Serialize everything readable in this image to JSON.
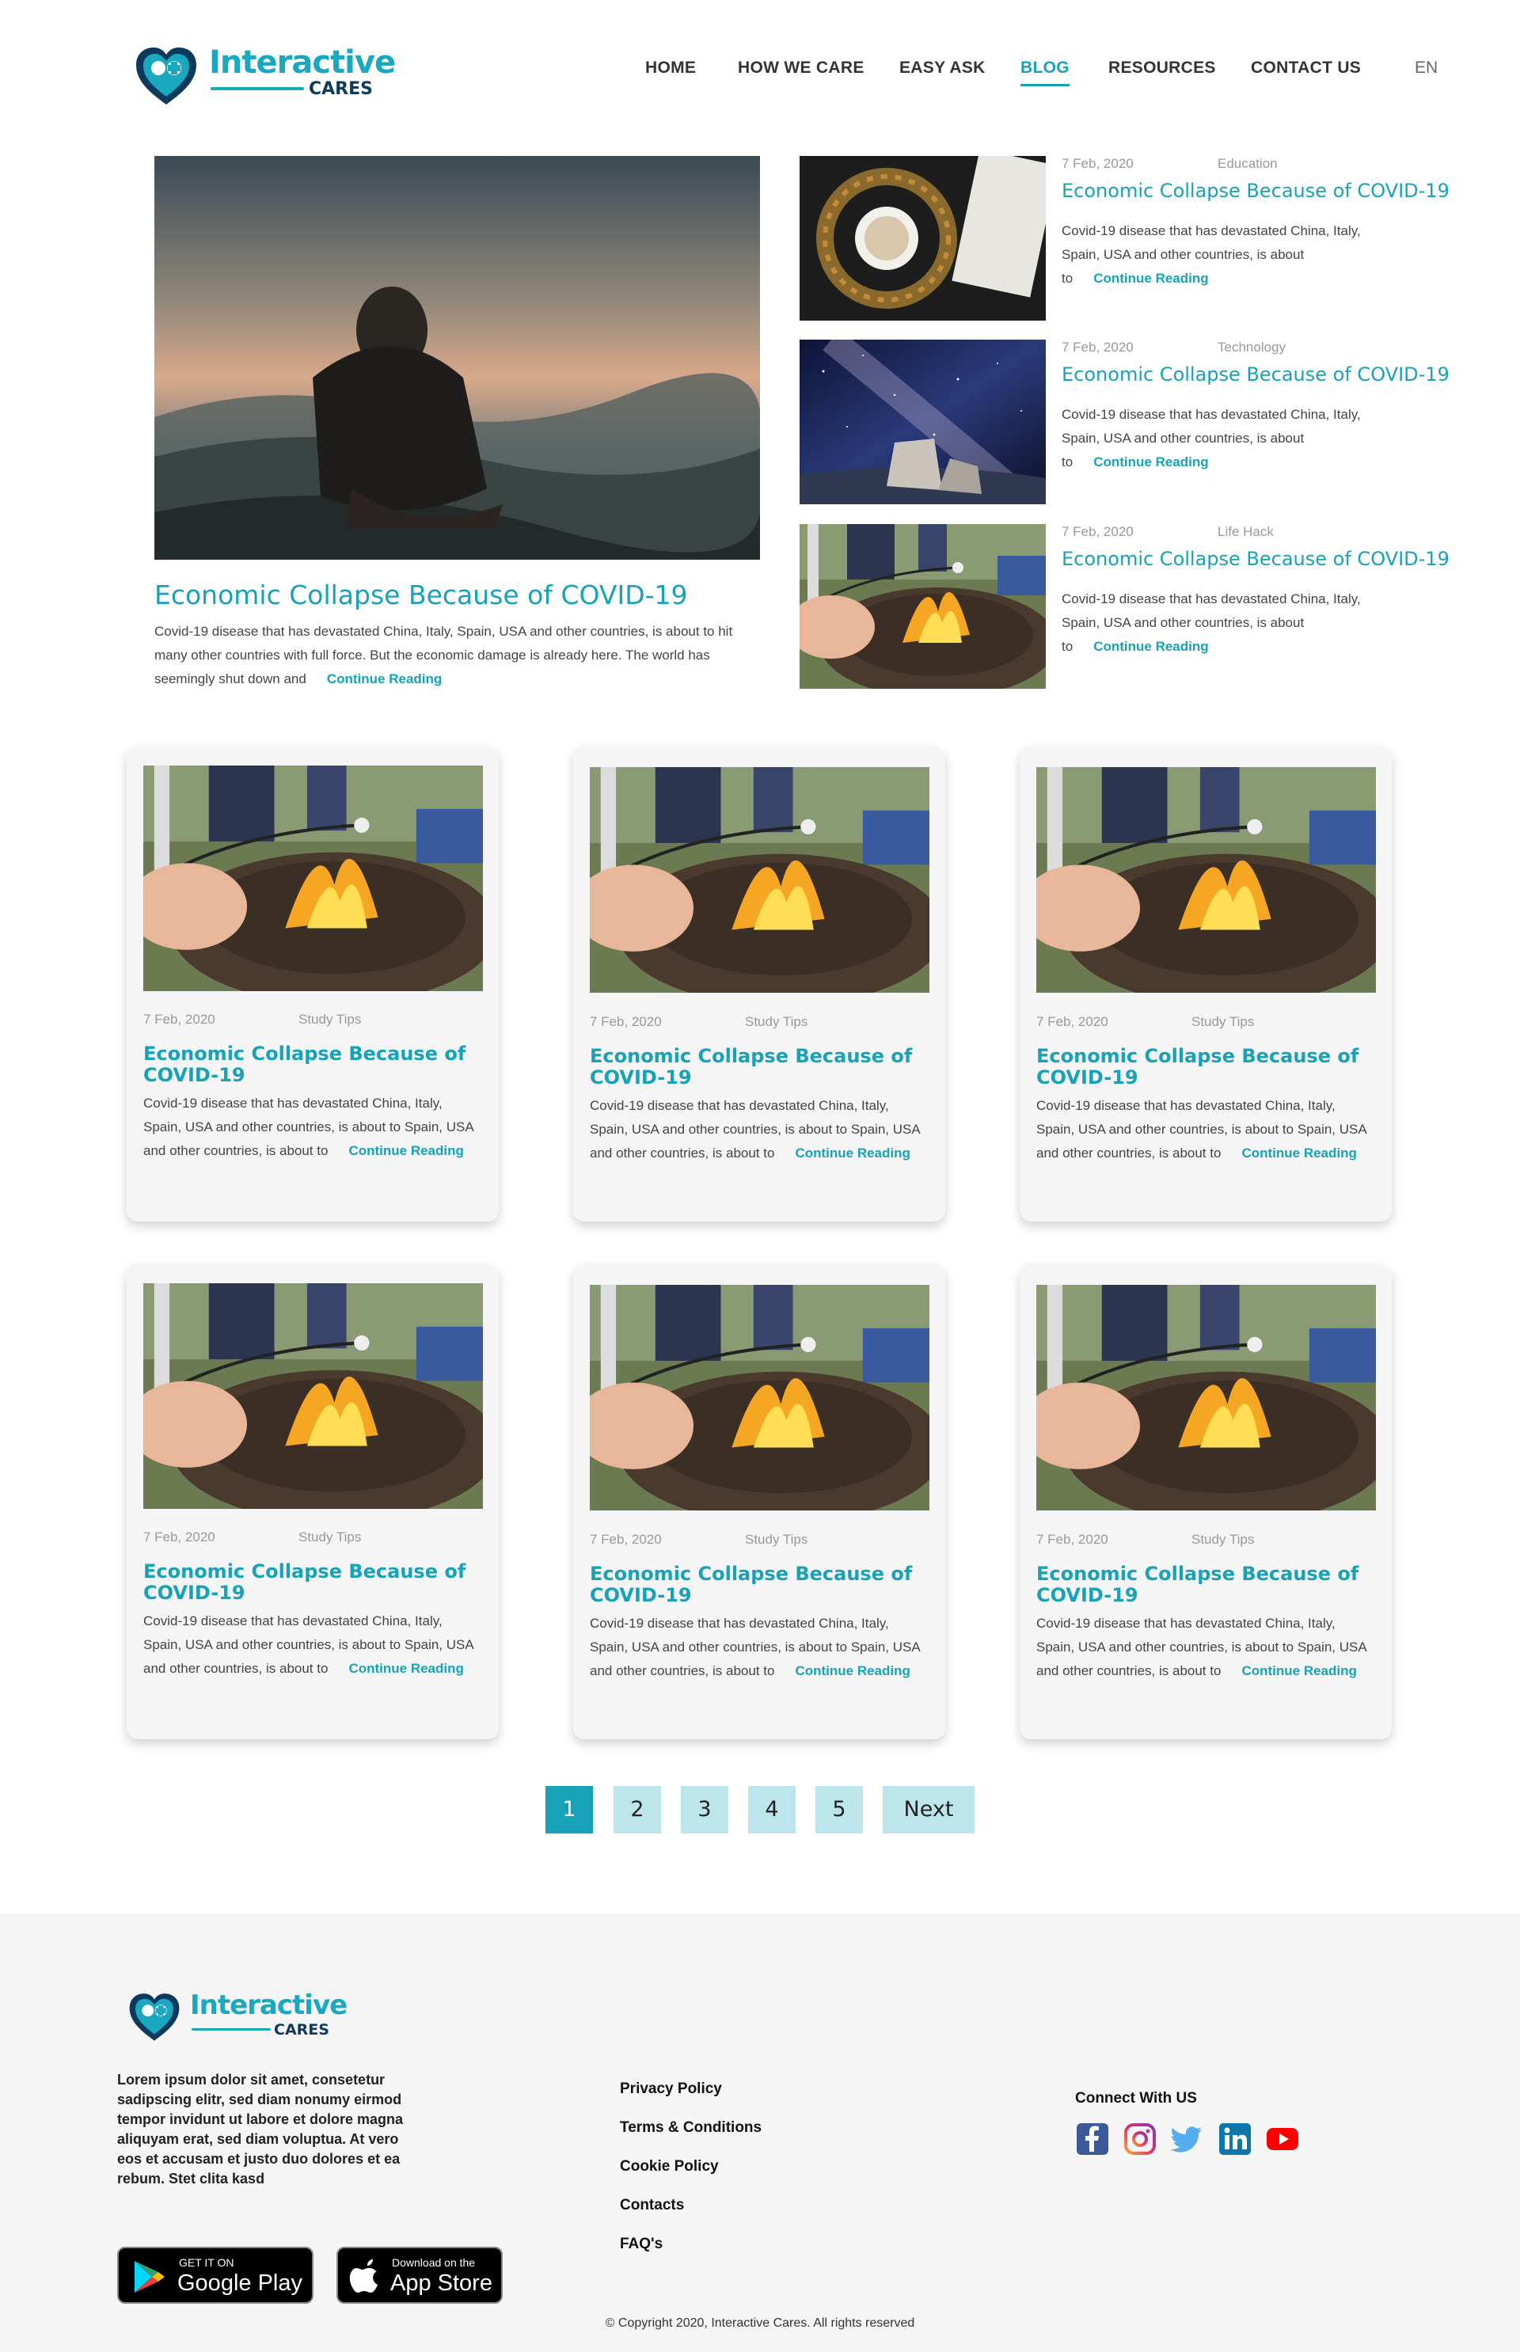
{
  "brand": {
    "name": "Interactive",
    "sub": "CARES",
    "accent": "#17a2b8",
    "dark": "#0d3a5c"
  },
  "nav": {
    "items": [
      {
        "label": "HOME",
        "active": false
      },
      {
        "label": "HOW WE CARE",
        "active": false
      },
      {
        "label": "EASY ASK",
        "active": false
      },
      {
        "label": "BLOG",
        "active": true
      },
      {
        "label": "RESOURCES",
        "active": false
      },
      {
        "label": "CONTACT US",
        "active": false
      }
    ],
    "lang": "EN"
  },
  "featured": {
    "title": "Economic Collapse Because of COVID-19",
    "text": "Covid-19 disease that has devastated China, Italy, Spain, USA and other countries, is about to hit many other countries with full force. But the economic damage is already here. The world has seemingly shut down and",
    "link": "Continue Reading"
  },
  "side": [
    {
      "date": "7 Feb, 2020",
      "category": "Education",
      "title": "Economic Collapse Because of COVID-19",
      "text": "Covid-19 disease that has devastated China, Italy, Spain, USA and other countries, is about to",
      "link": "Continue Reading"
    },
    {
      "date": "7 Feb, 2020",
      "category": "Technology",
      "title": "Economic Collapse Because of COVID-19",
      "text": "Covid-19 disease that has devastated China, Italy, Spain, USA and other countries, is about to",
      "link": "Continue Reading"
    },
    {
      "date": "7 Feb, 2020",
      "category": "Life Hack",
      "title": "Economic Collapse Because of COVID-19",
      "text": "Covid-19 disease that has devastated China, Italy, Spain, USA and other countries, is about to",
      "link": "Continue Reading"
    }
  ],
  "cards": [
    {
      "date": "7 Feb, 2020",
      "category": "Study Tips",
      "title": "Economic Collapse Because of COVID-19",
      "text": "Covid-19 disease that has devastated China, Italy, Spain, USA and other countries, is about to Spain, USA and other countries, is about to",
      "link": "Continue Reading"
    },
    {
      "date": "7 Feb, 2020",
      "category": "Study Tips",
      "title": "Economic Collapse Because of COVID-19",
      "text": "Covid-19 disease that has devastated China, Italy, Spain, USA and other countries, is about to Spain, USA and other countries, is about to",
      "link": "Continue Reading"
    },
    {
      "date": "7 Feb, 2020",
      "category": "Study Tips",
      "title": "Economic Collapse Because of COVID-19",
      "text": "Covid-19 disease that has devastated China, Italy, Spain, USA and other countries, is about to Spain, USA and other countries, is about to",
      "link": "Continue Reading"
    },
    {
      "date": "7 Feb, 2020",
      "category": "Study Tips",
      "title": "Economic Collapse Because of COVID-19",
      "text": "Covid-19 disease that has devastated China, Italy, Spain, USA and other countries, is about to Spain, USA and other countries, is about to",
      "link": "Continue Reading"
    },
    {
      "date": "7 Feb, 2020",
      "category": "Study Tips",
      "title": "Economic Collapse Because of COVID-19",
      "text": "Covid-19 disease that has devastated China, Italy, Spain, USA and other countries, is about to Spain, USA and other countries, is about to",
      "link": "Continue Reading"
    },
    {
      "date": "7 Feb, 2020",
      "category": "Study Tips",
      "title": "Economic Collapse Because of COVID-19",
      "text": "Covid-19 disease that has devastated China, Italy, Spain, USA and other countries, is about to Spain, USA and other countries, is about to",
      "link": "Continue Reading"
    }
  ],
  "pagination": {
    "pages": [
      "1",
      "2",
      "3",
      "4",
      "5"
    ],
    "current": "1",
    "next": "Next"
  },
  "footer": {
    "about": "Lorem ipsum dolor sit amet, consetetur sadipscing elitr, sed diam nonumy eirmod tempor invidunt ut labore et dolore magna aliquyam erat, sed diam voluptua. At vero eos et accusam et justo duo dolores et ea rebum. Stet clita kasd",
    "links": [
      "Privacy Policy",
      "Terms & Conditions",
      "Cookie Policy",
      "Contacts",
      "FAQ's"
    ],
    "connect": "Connect With US",
    "socials": [
      "facebook-icon",
      "instagram-icon",
      "twitter-icon",
      "linkedin-icon",
      "youtube-icon"
    ],
    "google_play": {
      "small": "GET IT ON",
      "big": "Google Play"
    },
    "app_store": {
      "small": "Download on the",
      "big": "App Store"
    },
    "copyright": "© Copyright 2020, Interactive Cares. All rights reserved"
  }
}
